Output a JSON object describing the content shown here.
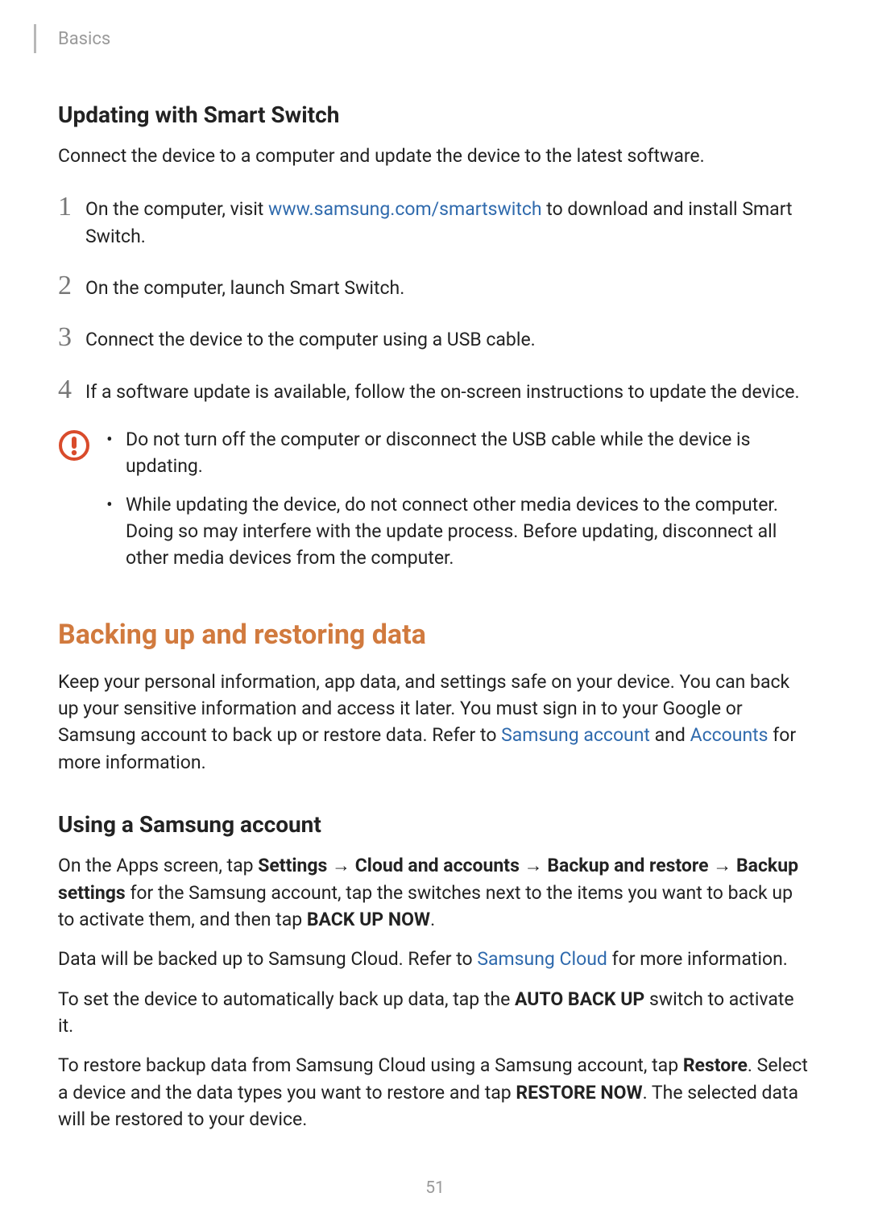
{
  "header": {
    "breadcrumb": "Basics"
  },
  "section1": {
    "heading": "Updating with Smart Switch",
    "intro": "Connect the device to a computer and update the device to the latest software.",
    "steps": {
      "s1": {
        "num": "1",
        "pre": "On the computer, visit ",
        "link": "www.samsung.com/smartswitch",
        "post": " to download and install Smart Switch."
      },
      "s2": {
        "num": "2",
        "text": "On the computer, launch Smart Switch."
      },
      "s3": {
        "num": "3",
        "text": "Connect the device to the computer using a USB cable."
      },
      "s4": {
        "num": "4",
        "text": "If a software update is available, follow the on-screen instructions to update the device."
      }
    },
    "caution": {
      "b1": "Do not turn off the computer or disconnect the USB cable while the device is updating.",
      "b2": "While updating the device, do not connect other media devices to the computer. Doing so may interfere with the update process. Before updating, disconnect all other media devices from the computer."
    }
  },
  "section2": {
    "heading": "Backing up and restoring data",
    "intro": {
      "pre": "Keep your personal information, app data, and settings safe on your device. You can back up your sensitive information and access it later. You must sign in to your Google or Samsung account to back up or restore data. Refer to ",
      "link1": "Samsung account",
      "mid": " and ",
      "link2": "Accounts",
      "post": " for more information."
    },
    "sub1": {
      "heading": "Using a Samsung account",
      "p1": {
        "t1": "On the Apps screen, tap ",
        "b1": "Settings",
        "t2": " → ",
        "b2": "Cloud and accounts",
        "t3": " → ",
        "b3": "Backup and restore",
        "t4": " → ",
        "b4": "Backup settings",
        "t5": " for the Samsung account, tap the switches next to the items you want to back up to activate them, and then tap ",
        "b5": "BACK UP NOW",
        "t6": "."
      },
      "p2": {
        "t1": "Data will be backed up to Samsung Cloud. Refer to ",
        "link": "Samsung Cloud",
        "t2": " for more information."
      },
      "p3": {
        "t1": "To set the device to automatically back up data, tap the ",
        "b1": "AUTO BACK UP",
        "t2": " switch to activate it."
      },
      "p4": {
        "t1": "To restore backup data from Samsung Cloud using a Samsung account, tap ",
        "b1": "Restore",
        "t2": ". Select a device and the data types you want to restore and tap ",
        "b2": "RESTORE NOW",
        "t3": ". The selected data will be restored to your device."
      }
    }
  },
  "pageNumber": "51"
}
